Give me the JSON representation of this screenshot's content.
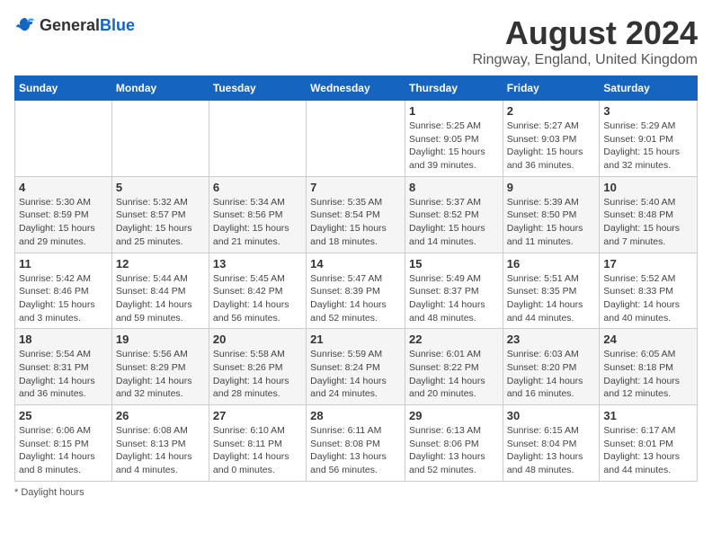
{
  "header": {
    "logo_general": "General",
    "logo_blue": "Blue",
    "month_title": "August 2024",
    "location": "Ringway, England, United Kingdom"
  },
  "days_of_week": [
    "Sunday",
    "Monday",
    "Tuesday",
    "Wednesday",
    "Thursday",
    "Friday",
    "Saturday"
  ],
  "footer": {
    "note": "Daylight hours"
  },
  "weeks": [
    [
      {
        "day": "",
        "info": ""
      },
      {
        "day": "",
        "info": ""
      },
      {
        "day": "",
        "info": ""
      },
      {
        "day": "",
        "info": ""
      },
      {
        "day": "1",
        "info": "Sunrise: 5:25 AM\nSunset: 9:05 PM\nDaylight: 15 hours\nand 39 minutes."
      },
      {
        "day": "2",
        "info": "Sunrise: 5:27 AM\nSunset: 9:03 PM\nDaylight: 15 hours\nand 36 minutes."
      },
      {
        "day": "3",
        "info": "Sunrise: 5:29 AM\nSunset: 9:01 PM\nDaylight: 15 hours\nand 32 minutes."
      }
    ],
    [
      {
        "day": "4",
        "info": "Sunrise: 5:30 AM\nSunset: 8:59 PM\nDaylight: 15 hours\nand 29 minutes."
      },
      {
        "day": "5",
        "info": "Sunrise: 5:32 AM\nSunset: 8:57 PM\nDaylight: 15 hours\nand 25 minutes."
      },
      {
        "day": "6",
        "info": "Sunrise: 5:34 AM\nSunset: 8:56 PM\nDaylight: 15 hours\nand 21 minutes."
      },
      {
        "day": "7",
        "info": "Sunrise: 5:35 AM\nSunset: 8:54 PM\nDaylight: 15 hours\nand 18 minutes."
      },
      {
        "day": "8",
        "info": "Sunrise: 5:37 AM\nSunset: 8:52 PM\nDaylight: 15 hours\nand 14 minutes."
      },
      {
        "day": "9",
        "info": "Sunrise: 5:39 AM\nSunset: 8:50 PM\nDaylight: 15 hours\nand 11 minutes."
      },
      {
        "day": "10",
        "info": "Sunrise: 5:40 AM\nSunset: 8:48 PM\nDaylight: 15 hours\nand 7 minutes."
      }
    ],
    [
      {
        "day": "11",
        "info": "Sunrise: 5:42 AM\nSunset: 8:46 PM\nDaylight: 15 hours\nand 3 minutes."
      },
      {
        "day": "12",
        "info": "Sunrise: 5:44 AM\nSunset: 8:44 PM\nDaylight: 14 hours\nand 59 minutes."
      },
      {
        "day": "13",
        "info": "Sunrise: 5:45 AM\nSunset: 8:42 PM\nDaylight: 14 hours\nand 56 minutes."
      },
      {
        "day": "14",
        "info": "Sunrise: 5:47 AM\nSunset: 8:39 PM\nDaylight: 14 hours\nand 52 minutes."
      },
      {
        "day": "15",
        "info": "Sunrise: 5:49 AM\nSunset: 8:37 PM\nDaylight: 14 hours\nand 48 minutes."
      },
      {
        "day": "16",
        "info": "Sunrise: 5:51 AM\nSunset: 8:35 PM\nDaylight: 14 hours\nand 44 minutes."
      },
      {
        "day": "17",
        "info": "Sunrise: 5:52 AM\nSunset: 8:33 PM\nDaylight: 14 hours\nand 40 minutes."
      }
    ],
    [
      {
        "day": "18",
        "info": "Sunrise: 5:54 AM\nSunset: 8:31 PM\nDaylight: 14 hours\nand 36 minutes."
      },
      {
        "day": "19",
        "info": "Sunrise: 5:56 AM\nSunset: 8:29 PM\nDaylight: 14 hours\nand 32 minutes."
      },
      {
        "day": "20",
        "info": "Sunrise: 5:58 AM\nSunset: 8:26 PM\nDaylight: 14 hours\nand 28 minutes."
      },
      {
        "day": "21",
        "info": "Sunrise: 5:59 AM\nSunset: 8:24 PM\nDaylight: 14 hours\nand 24 minutes."
      },
      {
        "day": "22",
        "info": "Sunrise: 6:01 AM\nSunset: 8:22 PM\nDaylight: 14 hours\nand 20 minutes."
      },
      {
        "day": "23",
        "info": "Sunrise: 6:03 AM\nSunset: 8:20 PM\nDaylight: 14 hours\nand 16 minutes."
      },
      {
        "day": "24",
        "info": "Sunrise: 6:05 AM\nSunset: 8:18 PM\nDaylight: 14 hours\nand 12 minutes."
      }
    ],
    [
      {
        "day": "25",
        "info": "Sunrise: 6:06 AM\nSunset: 8:15 PM\nDaylight: 14 hours\nand 8 minutes."
      },
      {
        "day": "26",
        "info": "Sunrise: 6:08 AM\nSunset: 8:13 PM\nDaylight: 14 hours\nand 4 minutes."
      },
      {
        "day": "27",
        "info": "Sunrise: 6:10 AM\nSunset: 8:11 PM\nDaylight: 14 hours\nand 0 minutes."
      },
      {
        "day": "28",
        "info": "Sunrise: 6:11 AM\nSunset: 8:08 PM\nDaylight: 13 hours\nand 56 minutes."
      },
      {
        "day": "29",
        "info": "Sunrise: 6:13 AM\nSunset: 8:06 PM\nDaylight: 13 hours\nand 52 minutes."
      },
      {
        "day": "30",
        "info": "Sunrise: 6:15 AM\nSunset: 8:04 PM\nDaylight: 13 hours\nand 48 minutes."
      },
      {
        "day": "31",
        "info": "Sunrise: 6:17 AM\nSunset: 8:01 PM\nDaylight: 13 hours\nand 44 minutes."
      }
    ]
  ]
}
